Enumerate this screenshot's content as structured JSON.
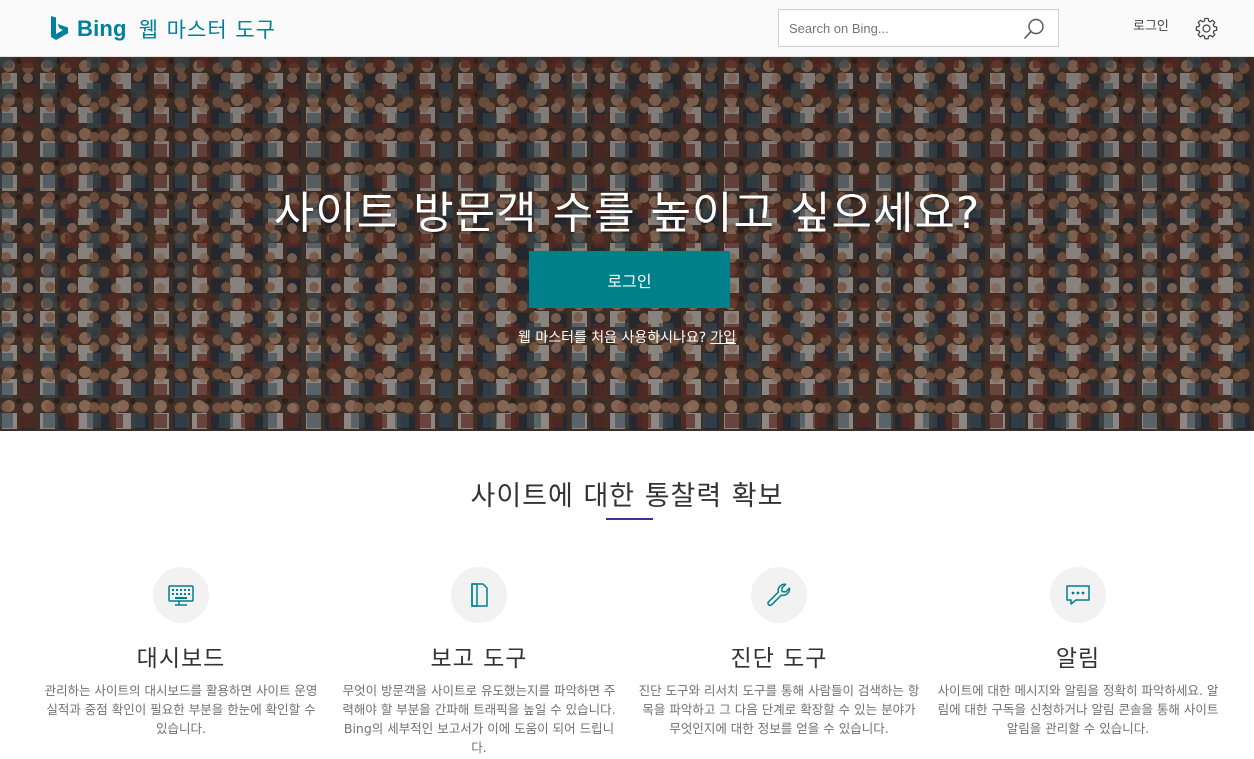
{
  "header": {
    "brand": "Bing",
    "product": "웹 마스터 도구",
    "search_placeholder": "Search on Bing...",
    "signin_label": "로그인"
  },
  "hero": {
    "headline": "사이트 방문객 수를 높이고 싶으세요?",
    "cta_label": "로그인",
    "subtext": "웹 마스터를 처음 사용하시나요?",
    "signup_link": "가입"
  },
  "insights": {
    "title": "사이트에 대한 통찰력 확보",
    "features": [
      {
        "icon": "keyboard-icon",
        "title": "대시보드",
        "description": "관리하는 사이트의 대시보드를 활용하면 사이트 운영 실적과 중점 확인이 필요한 부분을 한눈에 확인할 수 있습니다."
      },
      {
        "icon": "document-icon",
        "title": "보고 도구",
        "description": "무엇이 방문객을 사이트로 유도했는지를 파악하면 주력해야 할 부분을 간파해 트래픽을 높일 수 있습니다. Bing의 세부적인 보고서가 이에 도움이 되어 드립니다."
      },
      {
        "icon": "wrench-icon",
        "title": "진단 도구",
        "description": "진단 도구와 리서치 도구를 통해 사람들이 검색하는 항목을 파악하고 그 다음 단계로 확장할 수 있는 분야가 무엇인지에 대한 정보를 얻을 수 있습니다."
      },
      {
        "icon": "chat-bubble-icon",
        "title": "알림",
        "description": "사이트에 대한 메시지와 알림을 정확히 파악하세요. 알림에 대한 구독을 신청하거나 알림 콘솔을 통해 사이트 알림을 관리할 수 있습니다."
      }
    ]
  },
  "colors": {
    "brand_teal": "#00809d",
    "cta_teal": "#00808b",
    "accent_rule": "#4a2c8c"
  }
}
